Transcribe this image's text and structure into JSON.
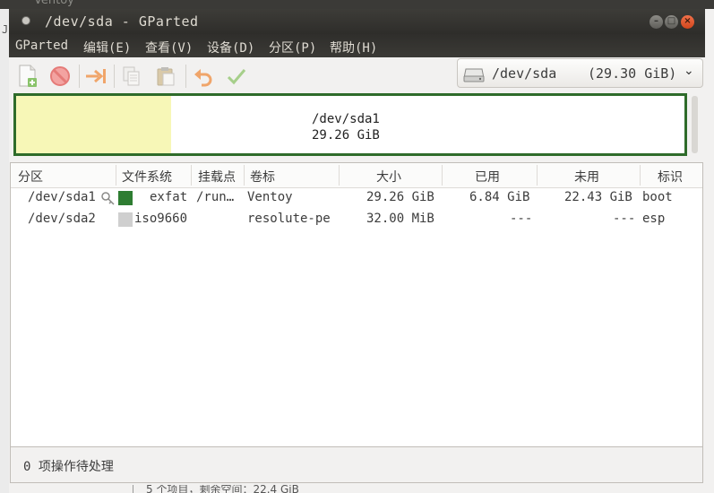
{
  "behind": {
    "top_title": "Ventoy",
    "left_char": "J",
    "bottom_status": "5 个项目，剩余空间：22.4 GiB"
  },
  "window": {
    "title": "/dev/sda - GParted"
  },
  "menu": [
    "GParted",
    "编辑(E)",
    "查看(V)",
    "设备(D)",
    "分区(P)",
    "帮助(H)"
  ],
  "toolbar": {
    "icons": [
      "new-partition-icon",
      "delete-icon",
      "resize-move-icon",
      "copy-icon",
      "paste-icon",
      "undo-icon",
      "apply-icon"
    ],
    "device": {
      "name": "/dev/sda",
      "size": "(29.30 GiB)"
    }
  },
  "partition_bar": {
    "name": "/dev/sda1",
    "size": "29.26 GiB",
    "used_fraction": 0.232,
    "used_color": "#f7f7b7",
    "border_color": "#2e6b2a"
  },
  "table": {
    "headers": [
      "分区",
      "文件系统",
      "挂载点",
      "卷标",
      "大小",
      "已用",
      "未用",
      "标识"
    ],
    "rows": [
      {
        "partition": "/dev/sda1",
        "fs_color": "#2e7d32",
        "filesystem": "exfat",
        "mount": "/run…",
        "label": "Ventoy",
        "size": "29.26 GiB",
        "used": "6.84 GiB",
        "unused": "22.43 GiB",
        "flags": "boot"
      },
      {
        "partition": "/dev/sda2",
        "fs_color": "#cfcfcf",
        "filesystem": "iso9660",
        "mount": "",
        "label": "resolute-pe",
        "size": "32.00 MiB",
        "used": "---",
        "unused": "---",
        "flags": "esp"
      }
    ]
  },
  "status": "0 项操作待处理"
}
